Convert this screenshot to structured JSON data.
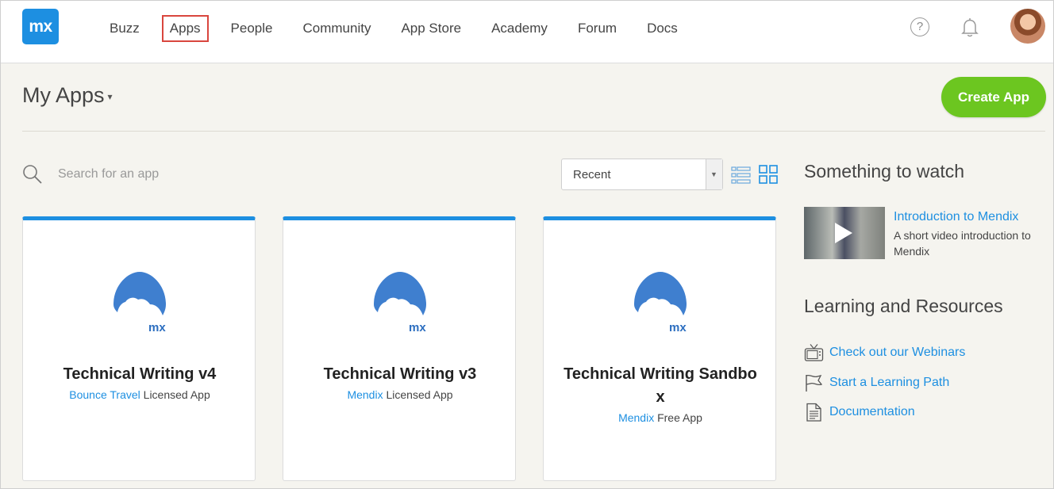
{
  "header": {
    "logo_text": "mx",
    "nav": [
      {
        "label": "Buzz"
      },
      {
        "label": "Apps",
        "active": true
      },
      {
        "label": "People"
      },
      {
        "label": "Community"
      },
      {
        "label": "App Store"
      },
      {
        "label": "Academy"
      },
      {
        "label": "Forum"
      },
      {
        "label": "Docs"
      }
    ],
    "help_icon_glyph": "?"
  },
  "page": {
    "title": "My Apps",
    "title_caret": "▾",
    "create_button": "Create App"
  },
  "search": {
    "placeholder": "Search for an app",
    "sort_selected": "Recent"
  },
  "apps": [
    {
      "name": "Technical Writing v4",
      "owner": "Bounce Travel",
      "license": "Licensed App"
    },
    {
      "name": "Technical Writing v3",
      "owner": "Mendix",
      "license": "Licensed App"
    },
    {
      "name": "Technical Writing Sandbox",
      "owner": "Mendix",
      "license": "Free App"
    }
  ],
  "watch": {
    "title": "Something to watch",
    "video_title": "Introduction to Mendix",
    "video_desc": "A short video introduction to Mendix"
  },
  "learning": {
    "title": "Learning and Resources",
    "items": [
      {
        "label": "Check out our Webinars",
        "icon": "tv-icon"
      },
      {
        "label": "Start a Learning Path",
        "icon": "flag-icon"
      },
      {
        "label": "Documentation",
        "icon": "document-icon"
      }
    ]
  },
  "app_logo_text": "mx",
  "colors": {
    "accent": "#1d8fe1",
    "create_button": "#6cc620",
    "highlight_box": "#d9463e",
    "page_bg": "#f5f4ef"
  }
}
